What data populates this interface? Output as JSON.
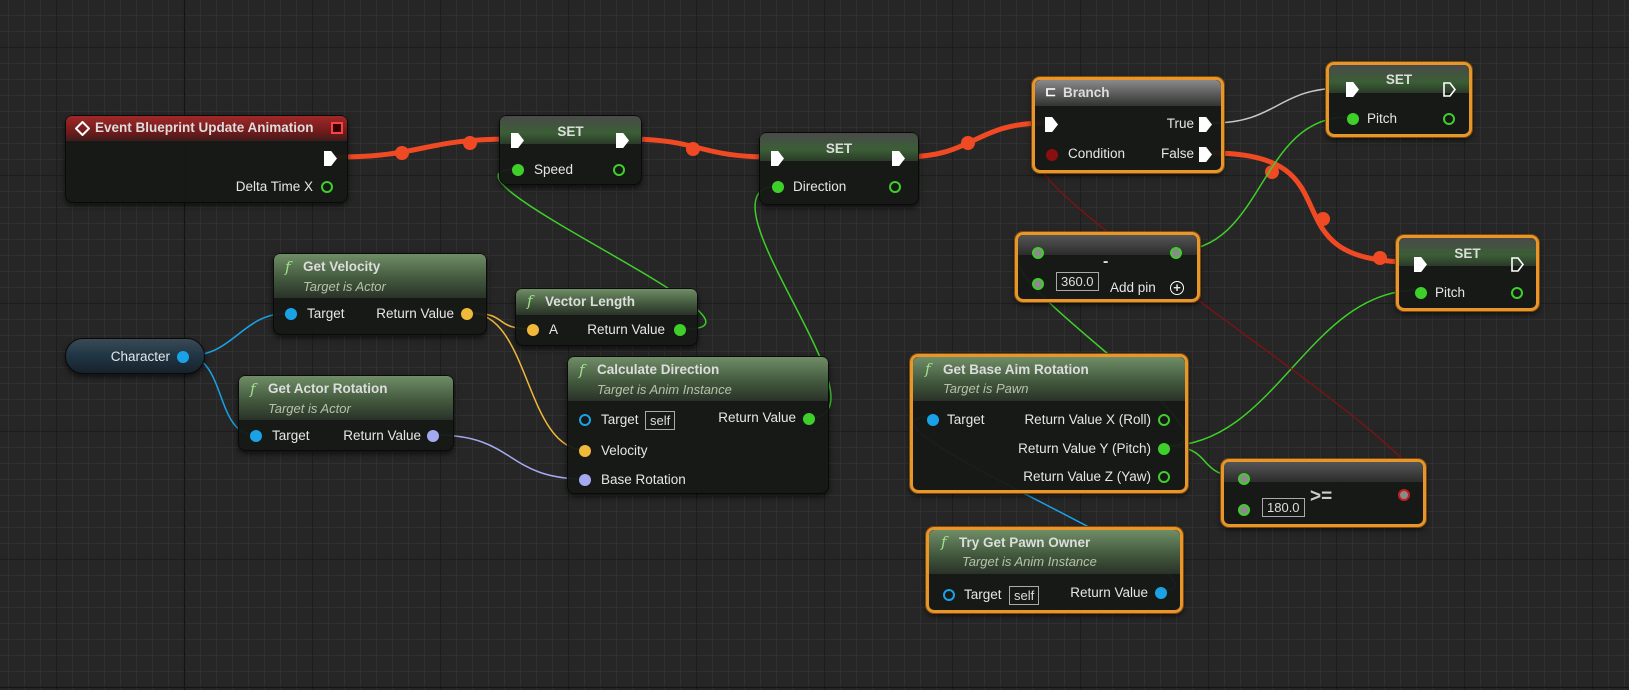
{
  "colors": {
    "exec": "#f04a24",
    "exec_idle": "#c8c8c8",
    "float": "#3fcf2a",
    "vector": "#f1b93a",
    "object": "#19a3e6",
    "rotator": "#a4aaf0",
    "bool": "#8a0f0f",
    "selection": "#e8962a"
  },
  "nodes": {
    "event": {
      "title": "Event Blueprint Update Animation",
      "out": "Delta Time X",
      "icon": "event-diamond-icon"
    },
    "set_speed": {
      "title": "SET",
      "pin": "Speed"
    },
    "set_direction": {
      "title": "SET",
      "pin": "Direction"
    },
    "branch": {
      "title": "Branch",
      "condition": "Condition",
      "true": "True",
      "false": "False"
    },
    "set_pitch_top": {
      "title": "SET",
      "pin": "Pitch"
    },
    "set_pitch_bottom": {
      "title": "SET",
      "pin": "Pitch"
    },
    "subtract": {
      "op": "-",
      "value": "360.0",
      "add_pin": "Add pin"
    },
    "get_velocity": {
      "title": "Get Velocity",
      "subtitle": "Target is Actor",
      "in": "Target",
      "out": "Return Value"
    },
    "vector_length": {
      "title": "Vector Length",
      "in": "A",
      "out": "Return Value"
    },
    "character": {
      "label": "Character"
    },
    "get_actor_rotation": {
      "title": "Get Actor Rotation",
      "subtitle": "Target is Actor",
      "in": "Target",
      "out": "Return Value"
    },
    "calculate_direction": {
      "title": "Calculate Direction",
      "subtitle": "Target is Anim Instance",
      "target": "Target",
      "self": "self",
      "out": "Return Value",
      "velocity": "Velocity",
      "base_rotation": "Base Rotation"
    },
    "get_base_aim_rotation": {
      "title": "Get Base Aim Rotation",
      "subtitle": "Target is Pawn",
      "in": "Target",
      "out_x": "Return Value X (Roll)",
      "out_y": "Return Value Y (Pitch)",
      "out_z": "Return Value Z (Yaw)"
    },
    "greater_equal": {
      "op": ">=",
      "value": "180.0"
    },
    "try_get_pawn_owner": {
      "title": "Try Get Pawn Owner",
      "subtitle": "Target is Anim Instance",
      "target": "Target",
      "self": "self",
      "out": "Return Value"
    }
  },
  "function_icon": "f"
}
